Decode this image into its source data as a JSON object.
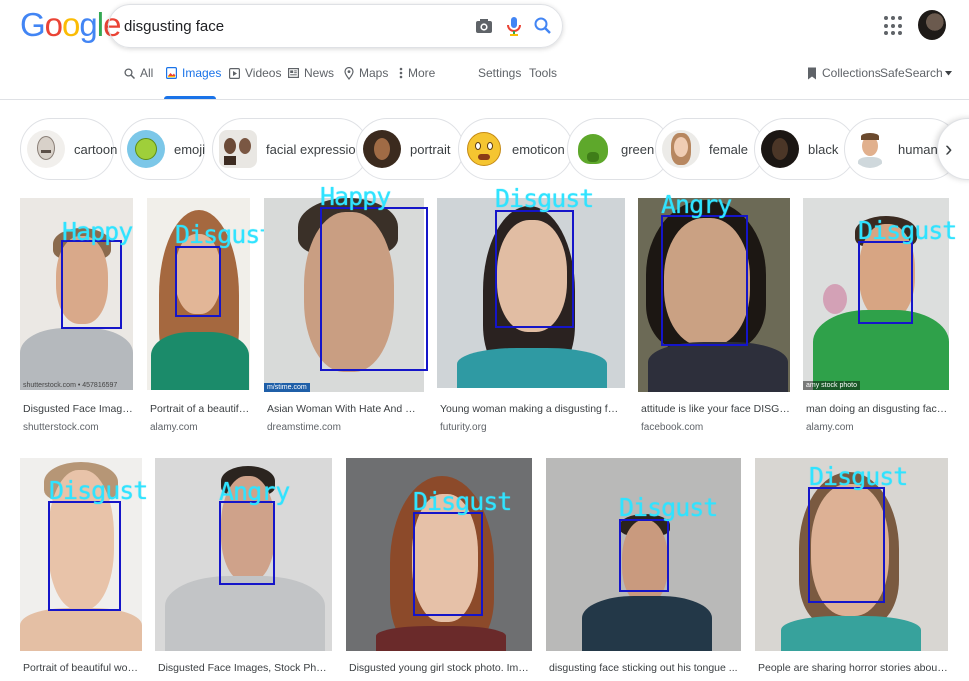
{
  "search": {
    "query": "disgusting face"
  },
  "logo": {
    "letters": [
      "G",
      "o",
      "o",
      "g",
      "l",
      "e"
    ],
    "colors": [
      "#4285f4",
      "#ea4335",
      "#fbbc05",
      "#4285f4",
      "#34a853",
      "#ea4335"
    ]
  },
  "tabs": [
    {
      "label": "All",
      "icon": "search-icon"
    },
    {
      "label": "Images",
      "icon": "image-icon",
      "active": true
    },
    {
      "label": "Videos",
      "icon": "play-icon"
    },
    {
      "label": "News",
      "icon": "newspaper-icon"
    },
    {
      "label": "Maps",
      "icon": "pin-icon"
    },
    {
      "label": "More",
      "icon": "dots-vertical-icon"
    }
  ],
  "tools": {
    "settings": "Settings",
    "tools": "Tools",
    "collections": "Collections",
    "safesearch": "SafeSearch"
  },
  "chips": [
    "cartoon",
    "emoji",
    "facial expression",
    "portrait",
    "emoticon",
    "green",
    "female",
    "black",
    "human"
  ],
  "results": [
    {
      "caption": "Disgusted Face Images, S...",
      "source": "shutterstock.com",
      "emotion": "Happy",
      "watermark": "shutterstock.com • 457816597"
    },
    {
      "caption": "Portrait of a beautiful y...",
      "source": "alamy.com",
      "emotion": "Disgust",
      "watermark": ""
    },
    {
      "caption": "Asian Woman With Hate And Disgusti...",
      "source": "dreamstime.com",
      "emotion": "Happy",
      "watermark": "m/stime.com"
    },
    {
      "caption": "Young woman making a disgusting face ...",
      "source": "futurity.org",
      "emotion": "Disgust",
      "watermark": ""
    },
    {
      "caption": "attitude is like your face DISGUSTI...",
      "source": "facebook.com",
      "emotion": "Angry",
      "watermark": ""
    },
    {
      "caption": "man doing an disgusting face whil...",
      "source": "alamy.com",
      "emotion": "Disgust",
      "watermark": "amy stock photo"
    },
    {
      "caption": "Portrait of beautiful woman ...",
      "source": "",
      "emotion": "Disgust",
      "watermark": ""
    },
    {
      "caption": "Disgusted Face Images, Stock Photos ...",
      "source": "",
      "emotion": "Angry",
      "watermark": ""
    },
    {
      "caption": "Disgusted young girl stock photo. Image ...",
      "source": "",
      "emotion": "Disgust",
      "watermark": ""
    },
    {
      "caption": "disgusting face sticking out his tongue ...",
      "source": "",
      "emotion": "Disgust",
      "watermark": ""
    },
    {
      "caption": "People are sharing horror stories about ...",
      "source": "",
      "emotion": "Disgust",
      "watermark": ""
    }
  ],
  "colors": {
    "accent": "#1a73e8",
    "box": "#1515c9",
    "emotion_label": "#30e3ff"
  }
}
